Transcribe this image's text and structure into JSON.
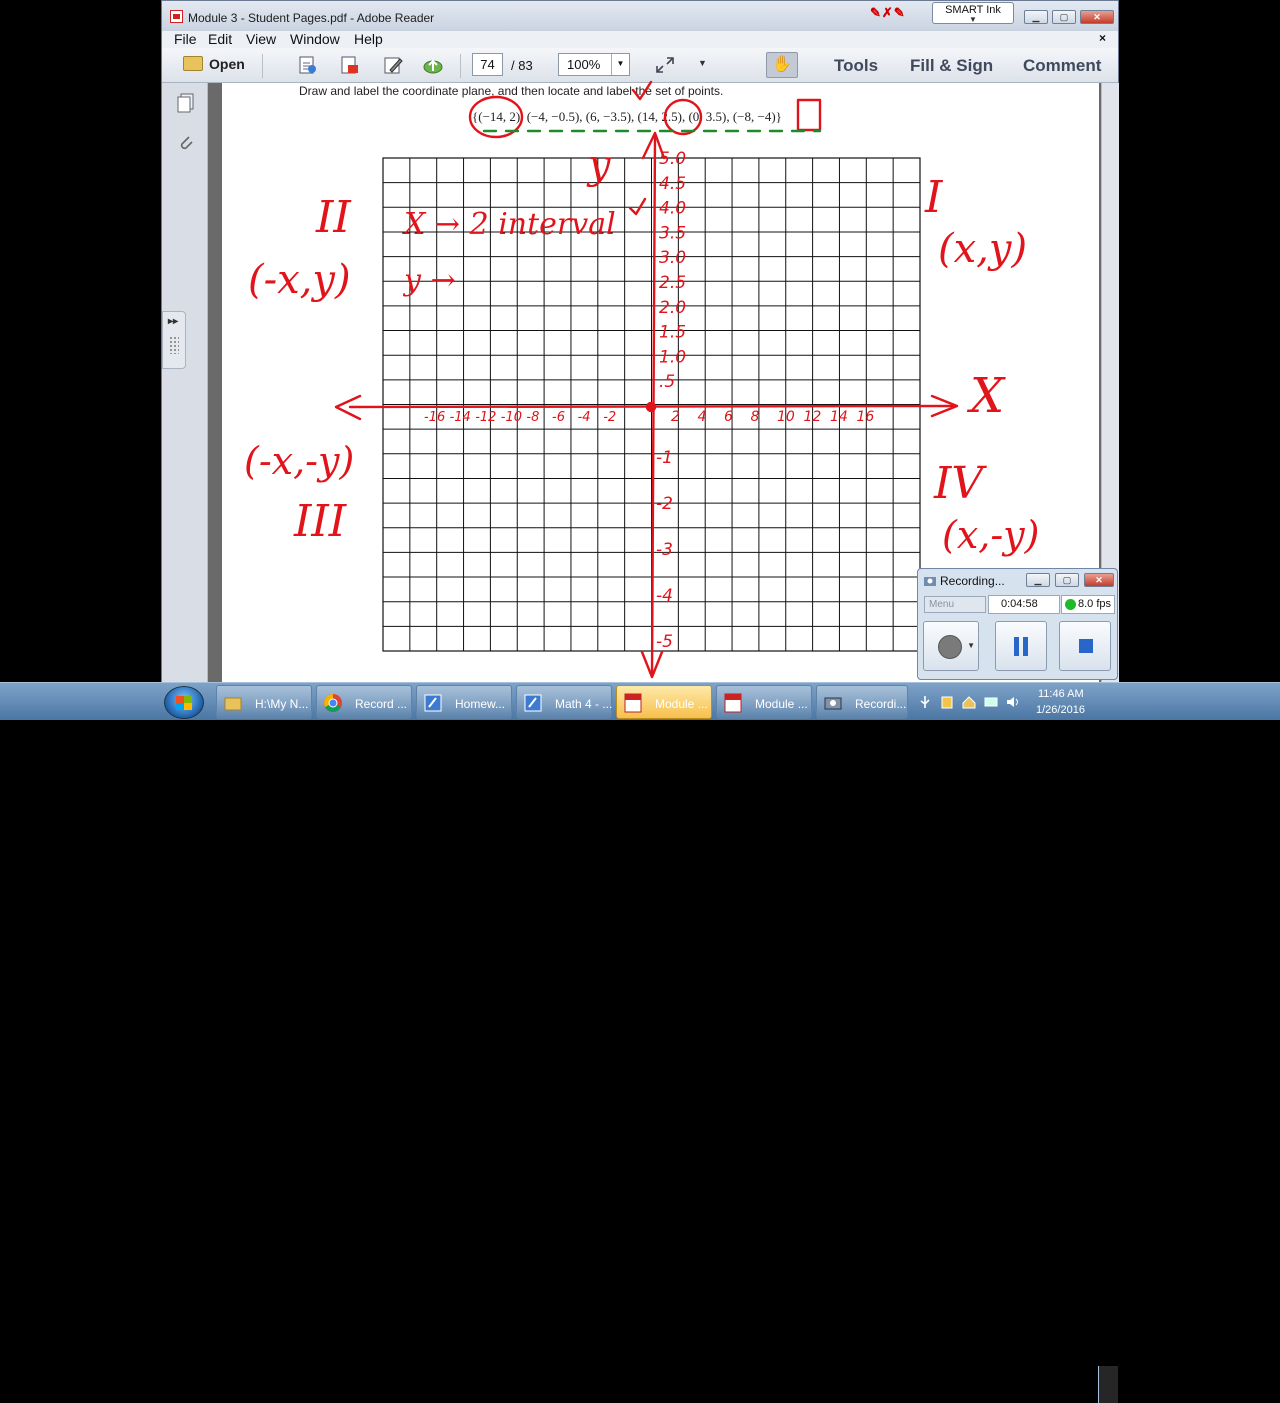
{
  "window": {
    "title": "Module 3 - Student Pages.pdf - Adobe Reader",
    "smart_ink_label": "SMART Ink",
    "menu": [
      "File",
      "Edit",
      "View",
      "Window",
      "Help"
    ],
    "menu_close": "×"
  },
  "toolbar": {
    "open_label": "Open",
    "page_current": "74",
    "page_total": "/ 83",
    "zoom": "100%",
    "tools_label": "Tools",
    "fill_sign_label": "Fill & Sign",
    "comment_label": "Comment"
  },
  "document": {
    "instruction": "Draw and label the coordinate plane, and then locate and label the set of points.",
    "points": "{(−14, 2), (−4, −0.5), (6, −3.5), (14, 2.5), (0, 3.5), (−8, −4)}"
  },
  "annotations": {
    "quadrants": [
      "II",
      "I",
      "III",
      "IV"
    ],
    "signs": [
      "(-x,y)",
      "(x,y)",
      "(-x,-y)",
      "(x,-y)"
    ],
    "x_label": "X",
    "y_label": "y",
    "note_x": "X → 2 interval",
    "note_y": "y →",
    "y_ticks_pos": [
      "5.0",
      "4.5",
      "4.0",
      "3.5",
      "3.0",
      "2.5",
      "2.0",
      "1.5",
      "1.0",
      ".5"
    ],
    "y_ticks_neg": [
      "-1",
      "-2",
      "-3",
      "-4",
      "-5"
    ],
    "x_ticks_neg": [
      "-16",
      "-14",
      "-12",
      "-10",
      "-8",
      "-6",
      "-4",
      "-2"
    ],
    "x_ticks_pos": [
      "2",
      "4",
      "6",
      "8",
      "10",
      "12",
      "14",
      "16"
    ]
  },
  "recorder": {
    "title": "Recording...",
    "menu": "Menu",
    "elapsed": "0:04:58",
    "fps": "8.0 fps"
  },
  "taskbar": {
    "items": [
      {
        "label": "H:\\My N..."
      },
      {
        "label": "Record ..."
      },
      {
        "label": "Homew..."
      },
      {
        "label": "Math 4 - ..."
      },
      {
        "label": "Module ..."
      },
      {
        "label": "Module ..."
      },
      {
        "label": "Recordi..."
      }
    ],
    "time": "11:46 AM",
    "date": "1/26/2016"
  },
  "colors": {
    "ink": "#e0141a",
    "grid": "#111111",
    "taskbar": "#4b76a3"
  }
}
